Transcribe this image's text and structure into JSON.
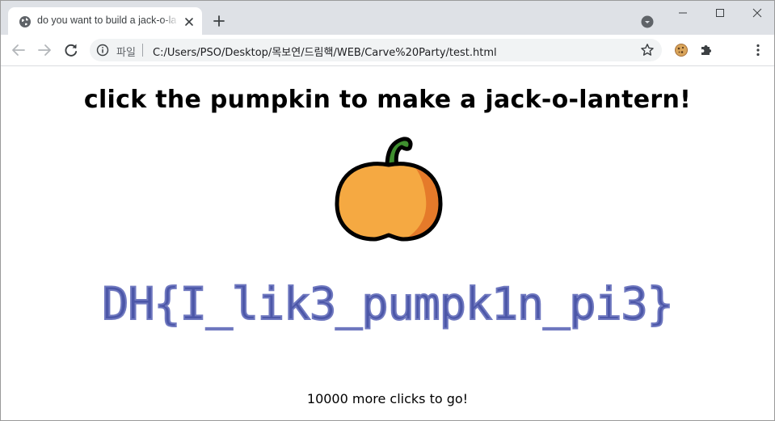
{
  "browser": {
    "tab": {
      "title": "do you want to build a jack-o-lantern?",
      "favicon": "globe-icon"
    },
    "new_tab_label": "+",
    "address_bar": {
      "scheme_label": "파일",
      "url": "C:/Users/PSO/Desktop/목보연/드림핵/WEB/Carve%20Party/test.html"
    },
    "toolbar_icons": [
      "back-arrow-icon",
      "forward-arrow-icon",
      "reload-icon",
      "info-icon",
      "star-icon",
      "cookie-extension-icon",
      "puzzle-extensions-icon",
      "kebab-menu-icon"
    ],
    "window_controls": [
      "minimize-icon",
      "maximize-icon",
      "close-icon"
    ]
  },
  "page": {
    "heading": "click the pumpkin to make a jack-o-lantern!",
    "pumpkin_icon": "pumpkin-icon",
    "flag_text": "DH{I_lik3_pumpk1n_pi3}",
    "counter_text": "10000 more clicks to go!"
  },
  "colors": {
    "tabstrip": "#dee1e6",
    "omnibox": "#f1f3f4",
    "pumpkin_body": "#f5a942",
    "pumpkin_shade": "#e57a2a",
    "pumpkin_stem": "#3f8f2f",
    "flag": "#4c57a8"
  }
}
